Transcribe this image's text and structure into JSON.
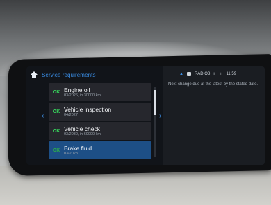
{
  "screen": {
    "title": "Service requirements",
    "items": [
      {
        "status": "OK",
        "name": "Engine oil",
        "detail": "03/2026, in 30000 km"
      },
      {
        "status": "OK",
        "name": "Vehicle inspection",
        "detail": "04/2027"
      },
      {
        "status": "OK",
        "name": "Vehicle check",
        "detail": "03/2030, in 60000 km"
      },
      {
        "status": "OK",
        "name": "Brake fluid",
        "detail": "03/2028"
      }
    ],
    "selected_index": 3,
    "status_bar": {
      "source": "RADIO3",
      "time": "11:59"
    },
    "note": "Next change due at the latest by the stated date."
  },
  "colors": {
    "accent": "#3a8ee6",
    "ok": "#37d45c",
    "selected": "#1d4f86"
  }
}
